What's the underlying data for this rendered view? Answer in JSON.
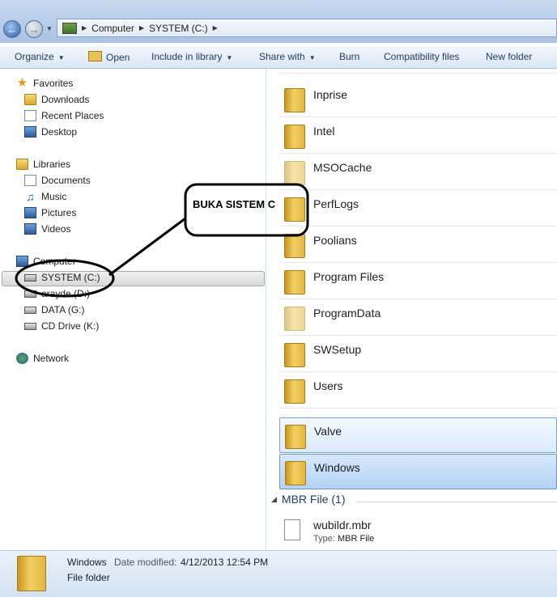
{
  "address": {
    "breadcrumbs": [
      "Computer",
      "SYSTEM (C:)"
    ]
  },
  "toolbar": {
    "organize": "Organize",
    "open": "Open",
    "include": "Include in library",
    "share": "Share with",
    "burn": "Burn",
    "compat": "Compatibility files",
    "new_folder": "New folder"
  },
  "nav": {
    "favorites": "Favorites",
    "downloads": "Downloads",
    "recent": "Recent Places",
    "desktop": "Desktop",
    "libraries": "Libraries",
    "documents": "Documents",
    "music": "Music",
    "pictures": "Pictures",
    "videos": "Videos",
    "computer": "Computer",
    "system_c": "SYSTEM (C:)",
    "drive_d": "arayde (D:)",
    "drive_g": "DATA (G:)",
    "drive_k": "CD Drive (K:)",
    "network": "Network"
  },
  "folders": [
    "Inprise",
    "Intel",
    "MSOCache",
    "PerfLogs",
    "Poolians",
    "Program Files",
    "ProgramData",
    "SWSetup",
    "Users",
    "Valve",
    "Windows"
  ],
  "mbr_group": {
    "header": "MBR File (1)",
    "file_name": "wubildr.mbr",
    "type_label": "Type:",
    "type_value": "MBR File"
  },
  "details": {
    "name": "Windows",
    "date_label": "Date modified:",
    "date_value": "4/12/2013 12:54 PM",
    "type": "File folder"
  },
  "annotation": {
    "text": "BUKA SISTEM C"
  }
}
